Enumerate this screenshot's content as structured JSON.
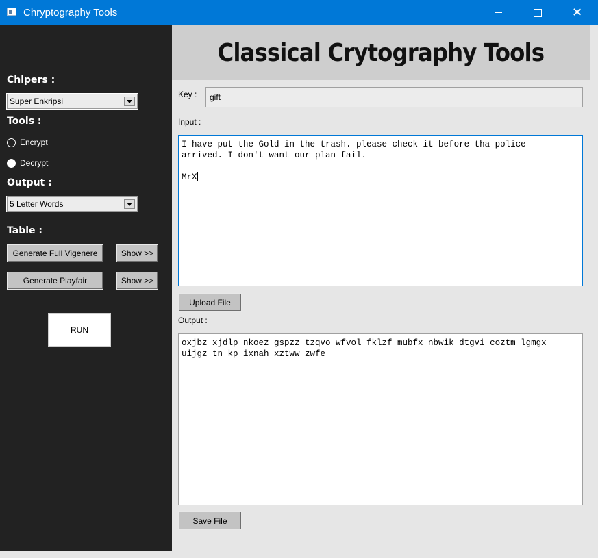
{
  "window": {
    "title": "Chryptography Tools",
    "controls": {
      "minimize": "—",
      "maximize": "",
      "close": "✕"
    }
  },
  "sidebar": {
    "ciphers_label": "Chipers :",
    "cipher_selected": "Super Enkripsi",
    "tools_label": "Tools :",
    "radio_encrypt": "Encrypt",
    "radio_decrypt": "Decrypt",
    "selected_tool": "Decrypt",
    "output_label": "Output :",
    "output_format_selected": "5 Letter Words",
    "table_label": "Table :",
    "gen_vigenere": "Generate Full Vigenere",
    "show_vigenere": "Show >>",
    "gen_playfair": "Generate Playfair",
    "show_playfair": "Show >>",
    "run": "RUN"
  },
  "main": {
    "header_title": "Classical Crytography Tools",
    "key_label": "Key :",
    "key_value": "gift",
    "input_label": "Input :",
    "input_text": "I have put the Gold in the trash. please check it before tha police\narrived. I don't want our plan fail.\n\nMrX",
    "upload_button": "Upload File",
    "output_label": "Output :",
    "output_text": "oxjbz xjdlp nkoez gspzz tzqvo wfvol fklzf mubfx nbwik dtgvi coztm lgmgx\nuijgz tn kp ixnah xztww zwfe",
    "save_button": "Save File"
  },
  "colors": {
    "titlebar": "#0078d7",
    "sidebar": "#222222",
    "banner": "#cecece",
    "content_bg": "#e6e6e6"
  }
}
